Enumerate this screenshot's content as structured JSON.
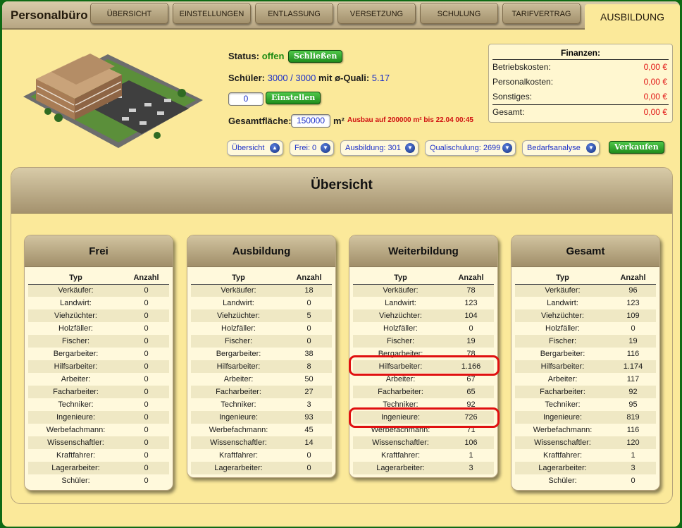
{
  "header": {
    "app_title": "Personalbüro",
    "tabs": [
      {
        "label": "ÜBERSICHT"
      },
      {
        "label": "EINSTELLUNGEN"
      },
      {
        "label": "ENTLASSUNG"
      },
      {
        "label": "VERSETZUNG"
      },
      {
        "label": "SCHULUNG"
      },
      {
        "label": "TARIFVERTRAG"
      },
      {
        "label": "AUSBILDUNG"
      }
    ]
  },
  "info": {
    "status_label": "Status:",
    "status_value": "offen",
    "close_button": "Schließen",
    "students_label": "Schüler:",
    "students_value": "3000 / 3000",
    "students_mid": "mit ø-Quali:",
    "students_quali": "5.17",
    "hire_value": "0",
    "hire_button": "Einstellen",
    "area_label": "Gesamtfläche:",
    "area_value": "150000",
    "area_unit": "m²",
    "expansion_note": "Ausbau auf 200000 m² bis 22.04 00:45"
  },
  "pills": [
    {
      "label": "Übersicht"
    },
    {
      "label": "Frei: 0"
    },
    {
      "label": "Ausbildung: 301"
    },
    {
      "label": "Qualischulung: 2699"
    },
    {
      "label": "Bedarfsanalyse"
    }
  ],
  "sell_button": "Verkaufen",
  "finance": {
    "title": "Finanzen:",
    "rows": [
      {
        "label": "Betriebskosten:",
        "value": "0,00 €"
      },
      {
        "label": "Personalkosten:",
        "value": "0,00 €"
      },
      {
        "label": "Sonstiges:",
        "value": "0,00 €"
      },
      {
        "label": "Gesamt:",
        "value": "0,00 €"
      }
    ]
  },
  "overview": {
    "title": "Übersicht",
    "col_type": "Typ",
    "col_count": "Anzahl",
    "cards": [
      {
        "title": "Frei",
        "rows": [
          [
            "Verkäufer:",
            "0"
          ],
          [
            "Landwirt:",
            "0"
          ],
          [
            "Viehzüchter:",
            "0"
          ],
          [
            "Holzfäller:",
            "0"
          ],
          [
            "Fischer:",
            "0"
          ],
          [
            "Bergarbeiter:",
            "0"
          ],
          [
            "Hilfsarbeiter:",
            "0"
          ],
          [
            "Arbeiter:",
            "0"
          ],
          [
            "Facharbeiter:",
            "0"
          ],
          [
            "Techniker:",
            "0"
          ],
          [
            "Ingenieure:",
            "0"
          ],
          [
            "Werbefachmann:",
            "0"
          ],
          [
            "Wissenschaftler:",
            "0"
          ],
          [
            "Kraftfahrer:",
            "0"
          ],
          [
            "Lagerarbeiter:",
            "0"
          ],
          [
            "Schüler:",
            "0"
          ]
        ]
      },
      {
        "title": "Ausbildung",
        "rows": [
          [
            "Verkäufer:",
            "18"
          ],
          [
            "Landwirt:",
            "0"
          ],
          [
            "Viehzüchter:",
            "5"
          ],
          [
            "Holzfäller:",
            "0"
          ],
          [
            "Fischer:",
            "0"
          ],
          [
            "Bergarbeiter:",
            "38"
          ],
          [
            "Hilfsarbeiter:",
            "8"
          ],
          [
            "Arbeiter:",
            "50"
          ],
          [
            "Facharbeiter:",
            "27"
          ],
          [
            "Techniker:",
            "3"
          ],
          [
            "Ingenieure:",
            "93"
          ],
          [
            "Werbefachmann:",
            "45"
          ],
          [
            "Wissenschaftler:",
            "14"
          ],
          [
            "Kraftfahrer:",
            "0"
          ],
          [
            "Lagerarbeiter:",
            "0"
          ]
        ]
      },
      {
        "title": "Weiterbildung",
        "rows": [
          [
            "Verkäufer:",
            "78"
          ],
          [
            "Landwirt:",
            "123"
          ],
          [
            "Viehzüchter:",
            "104"
          ],
          [
            "Holzfäller:",
            "0"
          ],
          [
            "Fischer:",
            "19"
          ],
          [
            "Bergarbeiter:",
            "78"
          ],
          [
            "Hilfsarbeiter:",
            "1.166"
          ],
          [
            "Arbeiter:",
            "67"
          ],
          [
            "Facharbeiter:",
            "65"
          ],
          [
            "Techniker:",
            "92"
          ],
          [
            "Ingenieure:",
            "726"
          ],
          [
            "Werbefachmann:",
            "71"
          ],
          [
            "Wissenschaftler:",
            "106"
          ],
          [
            "Kraftfahrer:",
            "1"
          ],
          [
            "Lagerarbeiter:",
            "3"
          ]
        ]
      },
      {
        "title": "Gesamt",
        "rows": [
          [
            "Verkäufer:",
            "96"
          ],
          [
            "Landwirt:",
            "123"
          ],
          [
            "Viehzüchter:",
            "109"
          ],
          [
            "Holzfäller:",
            "0"
          ],
          [
            "Fischer:",
            "19"
          ],
          [
            "Bergarbeiter:",
            "116"
          ],
          [
            "Hilfsarbeiter:",
            "1.174"
          ],
          [
            "Arbeiter:",
            "117"
          ],
          [
            "Facharbeiter:",
            "92"
          ],
          [
            "Techniker:",
            "95"
          ],
          [
            "Ingenieure:",
            "819"
          ],
          [
            "Werbefachmann:",
            "116"
          ],
          [
            "Wissenschaftler:",
            "120"
          ],
          [
            "Kraftfahrer:",
            "1"
          ],
          [
            "Lagerarbeiter:",
            "3"
          ],
          [
            "Schüler:",
            "0"
          ]
        ]
      }
    ]
  },
  "colors": {
    "highlight": "#e01010",
    "accent_green": "#1d8a11",
    "link_blue": "#1b2fc9"
  }
}
